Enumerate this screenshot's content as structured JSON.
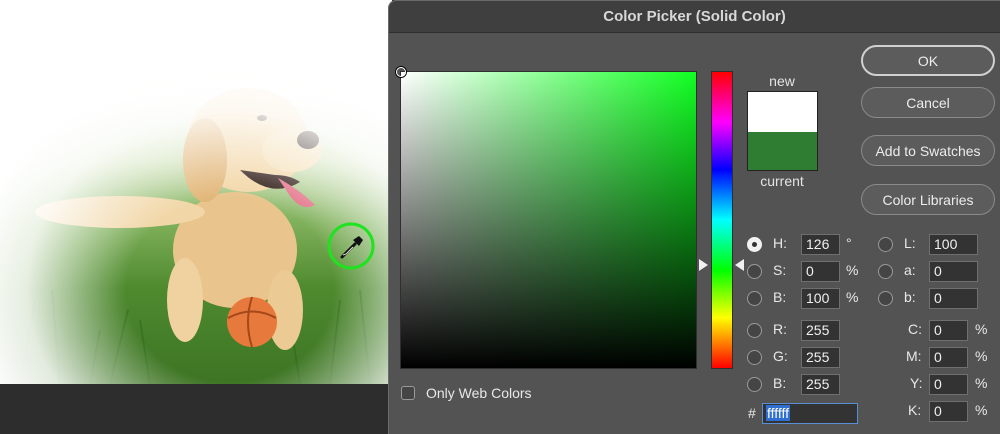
{
  "window": {
    "title": "Color Picker (Solid Color)"
  },
  "swatch": {
    "new_label": "new",
    "current_label": "current",
    "new_color": "#ffffff",
    "current_color": "#2e7d32"
  },
  "buttons": {
    "ok": "OK",
    "cancel": "Cancel",
    "add_to_swatches": "Add to Swatches",
    "color_libraries": "Color Libraries"
  },
  "hsb": {
    "h": {
      "label": "H:",
      "value": "126",
      "unit": "°",
      "selected": true
    },
    "s": {
      "label": "S:",
      "value": "0",
      "unit": "%"
    },
    "b": {
      "label": "B:",
      "value": "100",
      "unit": "%"
    }
  },
  "rgb": {
    "r": {
      "label": "R:",
      "value": "255"
    },
    "g": {
      "label": "G:",
      "value": "255"
    },
    "b": {
      "label": "B:",
      "value": "255"
    }
  },
  "lab": {
    "l": {
      "label": "L:",
      "value": "100"
    },
    "a": {
      "label": "a:",
      "value": "0"
    },
    "b": {
      "label": "b:",
      "value": "0"
    }
  },
  "cmyk": {
    "c": {
      "label": "C:",
      "value": "0",
      "unit": "%"
    },
    "m": {
      "label": "M:",
      "value": "0",
      "unit": "%"
    },
    "y": {
      "label": "Y:",
      "value": "0",
      "unit": "%"
    },
    "k": {
      "label": "K:",
      "value": "0",
      "unit": "%"
    }
  },
  "hex": {
    "prefix": "#",
    "value": "ffffff"
  },
  "only_web_colors": {
    "label": "Only Web Colors",
    "checked": false
  },
  "icons": {
    "eyedropper": "eyedropper-icon"
  }
}
